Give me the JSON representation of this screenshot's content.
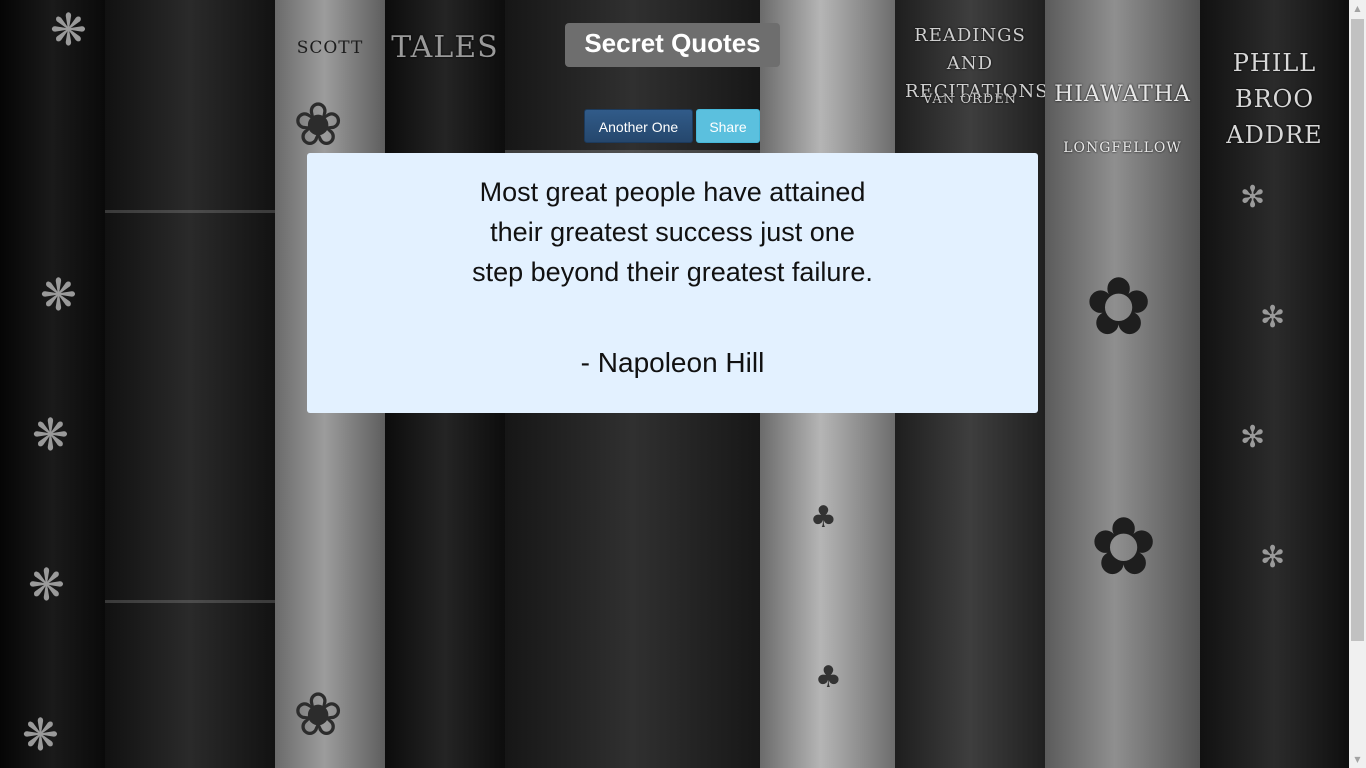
{
  "app": {
    "title": "Secret Quotes"
  },
  "buttons": {
    "another_label": "Another One",
    "share_label": "Share"
  },
  "quote": {
    "text": "Most great people have attained their greatest success just one step beyond their greatest failure.",
    "author": "- Napoleon Hill"
  },
  "background": {
    "book_labels": {
      "scott": "SCOTT",
      "tales": "TALES",
      "readings": "READINGS AND RECITATIONS",
      "van_orden": "VAN ORDEN",
      "hiawatha": "HIAWATHA",
      "longfellow": "LONGFELLOW",
      "phillips": "PHILL BROO ADDRE"
    }
  },
  "colors": {
    "title_bg": "#6e6e6e",
    "another_button": "#2b4f79",
    "share_button": "#5bc0de",
    "card_bg": "#e3f1ff"
  },
  "scrollbar": {
    "up_icon": "scroll-up-arrow-icon",
    "down_icon": "scroll-down-arrow-icon"
  }
}
